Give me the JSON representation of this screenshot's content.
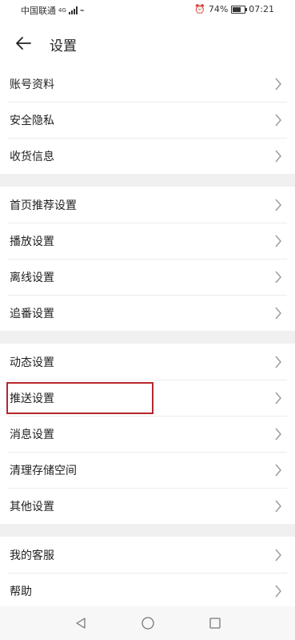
{
  "status_bar": {
    "carrier": "中国联通",
    "network": "4G",
    "battery": "74%",
    "battery_level": 0.74,
    "time": "07:21"
  },
  "header": {
    "title": "设置"
  },
  "settings_groups": [
    {
      "items": [
        {
          "label": "账号资料"
        },
        {
          "label": "安全隐私"
        },
        {
          "label": "收货信息"
        }
      ]
    },
    {
      "items": [
        {
          "label": "首页推荐设置"
        },
        {
          "label": "播放设置"
        },
        {
          "label": "离线设置"
        },
        {
          "label": "追番设置"
        }
      ]
    },
    {
      "items": [
        {
          "label": "动态设置"
        },
        {
          "label": "推送设置"
        },
        {
          "label": "消息设置"
        },
        {
          "label": "清理存储空间"
        },
        {
          "label": "其他设置"
        }
      ]
    },
    {
      "items": [
        {
          "label": "我的客服"
        },
        {
          "label": "帮助"
        }
      ]
    }
  ],
  "highlight_color": "#b4262d",
  "icons": {
    "back": "arrow-left-icon",
    "chevron": "chevron-right-icon",
    "nav": [
      "back-triangle-icon",
      "home-circle-icon",
      "recents-square-icon"
    ]
  }
}
